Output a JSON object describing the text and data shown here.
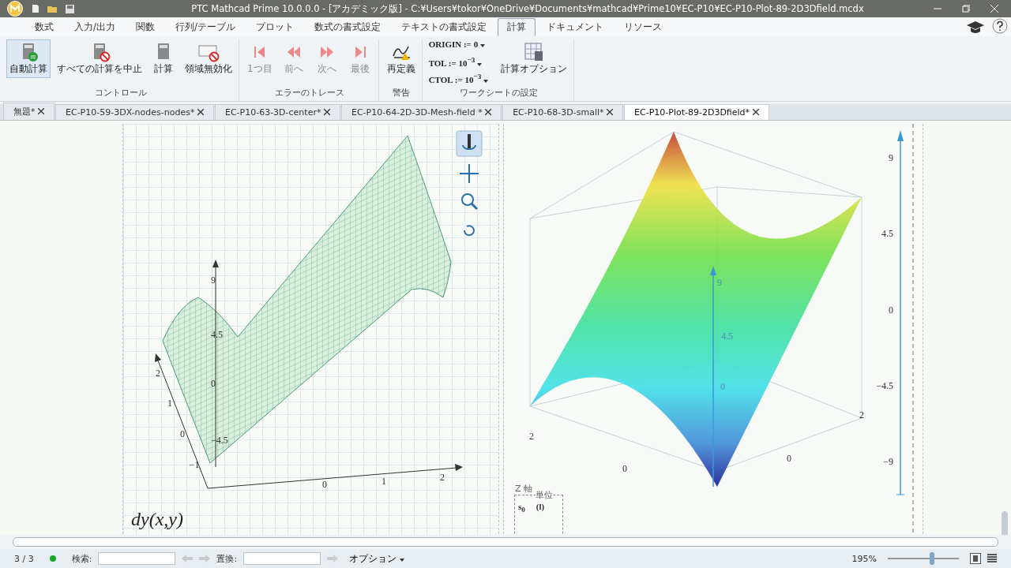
{
  "title_bar": {
    "title": "PTC Mathcad Prime 10.0.0.0 - [アカデミック版] - C:¥Users¥tokor¥OneDrive¥Documents¥mathcad¥Prime10¥EC-P10¥EC-P10-Plot-89-2D3Dfield.mcdx"
  },
  "ribbon_tabs": [
    {
      "label": "数式",
      "selected": false
    },
    {
      "label": "入力/出力",
      "selected": false
    },
    {
      "label": "関数",
      "selected": false
    },
    {
      "label": "行列/テーブル",
      "selected": false
    },
    {
      "label": "プロット",
      "selected": false
    },
    {
      "label": "数式の書式設定",
      "selected": false
    },
    {
      "label": "テキストの書式設定",
      "selected": false
    },
    {
      "label": "計算",
      "selected": true
    },
    {
      "label": "ドキュメント",
      "selected": false
    },
    {
      "label": "リソース",
      "selected": false
    }
  ],
  "ribbon_groups": [
    {
      "label": "コントロール",
      "items": [
        {
          "kind": "button",
          "label": "自動計算",
          "selected": true,
          "disabled": false
        },
        {
          "kind": "button",
          "label": "すべての計算を中止",
          "selected": false,
          "disabled": false
        },
        {
          "kind": "button",
          "label": "計算",
          "selected": false,
          "disabled": false
        },
        {
          "kind": "button",
          "label": "領域無効化",
          "selected": false,
          "disabled": false
        }
      ]
    },
    {
      "label": "エラーのトレース",
      "items": [
        {
          "kind": "button",
          "label": "1つ目",
          "selected": false,
          "disabled": true
        },
        {
          "kind": "button",
          "label": "前へ",
          "selected": false,
          "disabled": true
        },
        {
          "kind": "button",
          "label": "次へ",
          "selected": false,
          "disabled": true
        },
        {
          "kind": "button",
          "label": "最後",
          "selected": false,
          "disabled": true
        }
      ]
    },
    {
      "label": "警告",
      "items": [
        {
          "kind": "button",
          "label": "再定義",
          "selected": false,
          "disabled": false
        }
      ]
    },
    {
      "label": "ワークシートの設定",
      "items": [
        {
          "kind": "setting",
          "label": "ORIGIN := 0"
        },
        {
          "kind": "setting",
          "label": "TOL := 10$^{−3}$"
        },
        {
          "kind": "setting",
          "label": "CTOL := 10$^{−3}$"
        },
        {
          "kind": "button",
          "label": "計算オプション",
          "selected": false,
          "disabled": false
        }
      ]
    }
  ],
  "doc_tabs": [
    {
      "label": "無題*",
      "selected": false
    },
    {
      "label": "EC-P10-59-3DX-nodes-nodes*",
      "selected": false
    },
    {
      "label": "EC-P10-63-3D-center*",
      "selected": false
    },
    {
      "label": "EC-P10-64-2D-3D-Mesh-field *",
      "selected": false
    },
    {
      "label": "EC-P10-68-3D-small*",
      "selected": false
    },
    {
      "label": "EC-P10-Plot-89-2D3Dfield*",
      "selected": true
    }
  ],
  "left_plot": {
    "z_ticks": [
      "9",
      "4.5",
      "0",
      "−4.5"
    ],
    "y_ticks": [
      "2",
      "1",
      "0",
      "−1"
    ],
    "x_ticks": [
      "0",
      "1",
      "2"
    ],
    "tools": [
      {
        "selected": true
      },
      {
        "selected": false
      },
      {
        "selected": false
      },
      {
        "selected": false
      }
    ],
    "label": "dy(x,y)"
  },
  "right_plot": {
    "axis_ticks": [
      "9",
      "4.5",
      "0",
      "−4.5",
      "−9"
    ],
    "inner_ticks": [
      "9",
      "4.5",
      "0"
    ],
    "base_ticks": [
      "2",
      "0",
      "0",
      "2"
    ],
    "legend": {
      "title": "Z 軸",
      "unit_header": "単位",
      "rows": [
        {
          "name": "s$_{0}$",
          "unit": "(l)"
        }
      ]
    }
  },
  "status_bar": {
    "page": "3 / 3",
    "search_label": "検索:",
    "replace_label": "置換:",
    "options": "オプション",
    "zoom": "195%",
    "zoom_level": {
      "level": 0.62
    }
  }
}
